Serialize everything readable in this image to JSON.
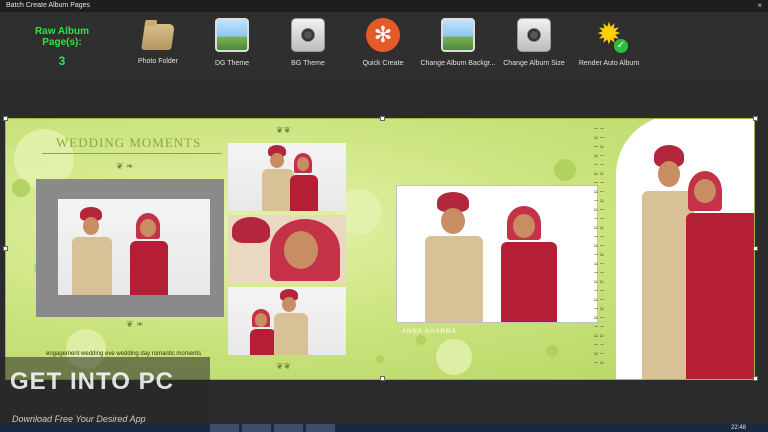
{
  "window": {
    "title": "Batch Create Album Pages",
    "close_glyph": "×"
  },
  "raw_album": {
    "label": "Raw Album Page(s):",
    "count": "3"
  },
  "toolbar": {
    "items": [
      {
        "label": "Photo Folder",
        "icon": "folder-icon"
      },
      {
        "label": "DG Theme",
        "icon": "landscape-icon"
      },
      {
        "label": "BG Theme",
        "icon": "camera-icon"
      },
      {
        "label": "Quick Create",
        "icon": "gear-icon"
      },
      {
        "label": "Change Album Backgr...",
        "icon": "landscape-icon"
      },
      {
        "label": "Change Album Size",
        "icon": "camera-icon"
      },
      {
        "label": "Render Auto  Album",
        "icon": "sun-check-icon"
      }
    ]
  },
  "album": {
    "heading": "WEDDING MOMENTS",
    "caption": "engagement wedding eve wedding day romantic moments",
    "main_caption": "ANNA SHARMA",
    "background_color": "#c8e27a"
  },
  "watermark": {
    "title": "GET INTO PC",
    "subtitle": "Download Free Your Desired App"
  },
  "taskbar": {
    "clock": "22:48"
  },
  "colors": {
    "accent_green": "#2ee24a",
    "toolbar_bg": "#2f2f2f"
  }
}
